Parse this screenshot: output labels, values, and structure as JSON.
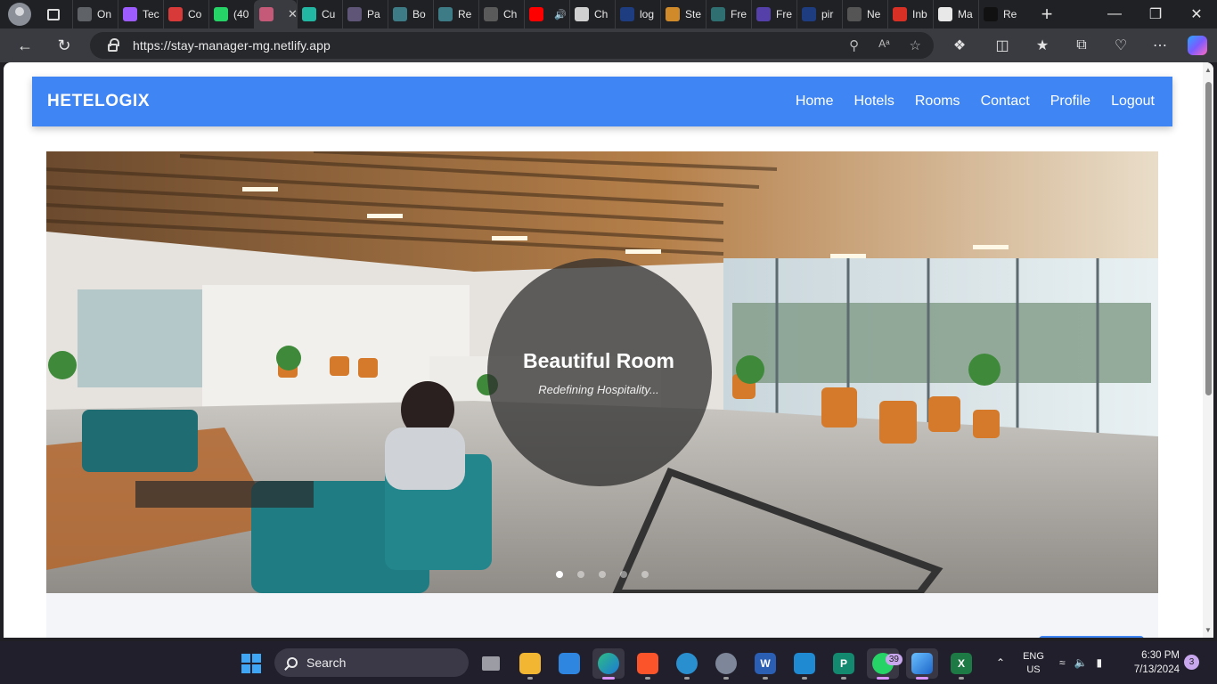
{
  "browser": {
    "tabs": [
      {
        "label": "On",
        "icon": "document-icon",
        "color": "#5f6368"
      },
      {
        "label": "Tec",
        "icon": "vite-icon",
        "color": "#9d5cff"
      },
      {
        "label": "Co",
        "icon": "loading-icon",
        "color": "#d83a3a"
      },
      {
        "label": "(40",
        "icon": "whatsapp-icon",
        "color": "#25d366"
      },
      {
        "label": "",
        "icon": "site-icon",
        "color": "#c45a78",
        "active": true
      },
      {
        "label": "Cu",
        "icon": "clickup-icon",
        "color": "#22b7a3"
      },
      {
        "label": "Pa",
        "icon": "site-icon",
        "color": "#5e5577"
      },
      {
        "label": "Bo",
        "icon": "react-icon",
        "color": "#3d7b86"
      },
      {
        "label": "Re",
        "icon": "react-icon",
        "color": "#3d7b86"
      },
      {
        "label": "Ch",
        "icon": "chatgpt-icon",
        "color": "#5a5a5a"
      },
      {
        "label": "",
        "icon": "youtube-icon",
        "color": "#ff0000"
      },
      {
        "label": "Ch",
        "icon": "chatgpt-icon",
        "color": "#d0d0d0"
      },
      {
        "label": "log",
        "icon": "search-icon",
        "color": "#1e3c80"
      },
      {
        "label": "Ste",
        "icon": "site-icon",
        "color": "#d08a2a"
      },
      {
        "label": "Fre",
        "icon": "site-icon",
        "color": "#2f6f72"
      },
      {
        "label": "Fre",
        "icon": "site-icon",
        "color": "#5440a8"
      },
      {
        "label": "pir",
        "icon": "search-icon",
        "color": "#1e3c80"
      },
      {
        "label": "Ne",
        "icon": "site-icon",
        "color": "#555555"
      },
      {
        "label": "Inb",
        "icon": "gmail-icon",
        "color": "#d93025"
      },
      {
        "label": "Ma",
        "icon": "site-icon",
        "color": "#e8e8e8"
      },
      {
        "label": "Re",
        "icon": "is-icon",
        "color": "#111111"
      }
    ],
    "audio_indicator": true,
    "url": "https://stay-manager-mg.netlify.app"
  },
  "site": {
    "brand": "HETELOGIX",
    "nav": [
      "Home",
      "Hotels",
      "Rooms",
      "Contact",
      "Profile",
      "Logout"
    ],
    "hero": {
      "title": "Beautiful Room",
      "subtitle": "Redefining Hospitality...",
      "slides_total": 5,
      "active_slide": 1
    }
  },
  "taskbar": {
    "search_placeholder": "Search",
    "whatsapp_badge": "39",
    "language": "ENG",
    "region": "US",
    "time": "6:30 PM",
    "date": "7/13/2024",
    "notifications": "3"
  },
  "colors": {
    "navbar": "#3f85f4",
    "caption_circle": "rgba(45,45,45,0.74)"
  }
}
